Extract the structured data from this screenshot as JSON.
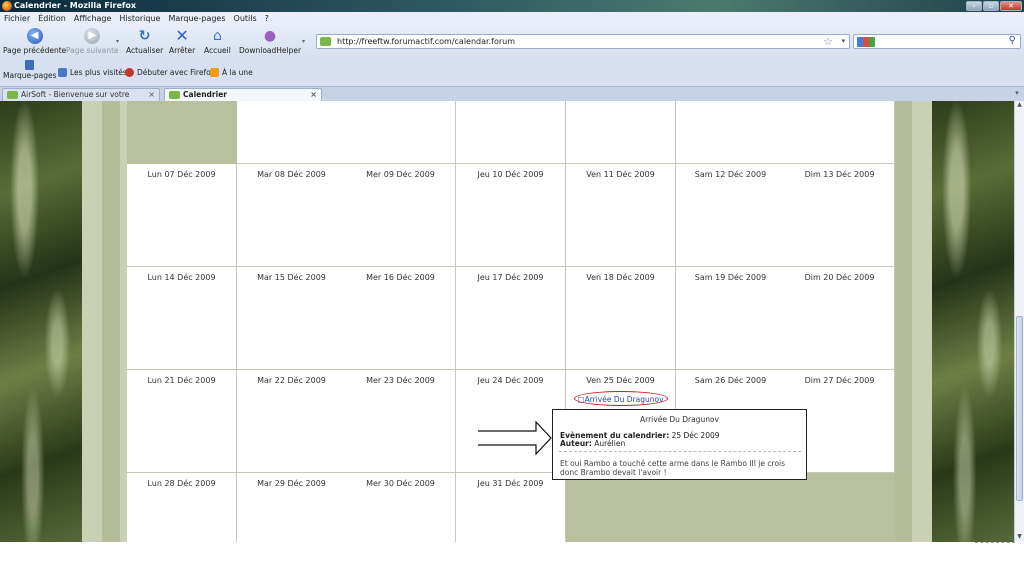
{
  "window": {
    "title": "Calendrier - Mozilla Firefox"
  },
  "menu": [
    "Fichier",
    "Édition",
    "Affichage",
    "Historique",
    "Marque-pages",
    "Outils",
    "?"
  ],
  "nav": {
    "back": "Page précédente",
    "forward": "Page suivante",
    "reload": "Actualiser",
    "stop": "Arrêter",
    "home": "Accueil",
    "downloadhelper": "DownloadHelper",
    "url": "http://freeftw.forumactif.com/calendar.forum",
    "search_value": ""
  },
  "bookmarks": {
    "main": "Marque-pages",
    "items": [
      "Les plus visités",
      "Débuter avec Firefox",
      "À la une"
    ]
  },
  "tabs": [
    {
      "label": "AirSoft - Bienvenue sur votre panne...",
      "active": false
    },
    {
      "label": "Calendrier",
      "active": true
    }
  ],
  "calendar": {
    "weeks": [
      [
        "",
        "",
        "",
        "",
        "",
        "",
        ""
      ],
      [
        "Lun 07 Déc 2009",
        "Mar 08 Déc 2009",
        "Mer 09 Déc 2009",
        "Jeu 10 Déc 2009",
        "Ven 11 Déc 2009",
        "Sam 12 Déc 2009",
        "Dim 13 Déc 2009"
      ],
      [
        "Lun 14 Déc 2009",
        "Mar 15 Déc 2009",
        "Mer 16 Déc 2009",
        "Jeu 17 Déc 2009",
        "Ven 18 Déc 2009",
        "Sam 19 Déc 2009",
        "Dim 20 Déc 2009"
      ],
      [
        "Lun 21 Déc 2009",
        "Mar 22 Déc 2009",
        "Mer 23 Déc 2009",
        "Jeu 24 Déc 2009",
        "Ven 25 Déc 2009",
        "Sam 26 Déc 2009",
        "Dim 27 Déc 2009"
      ],
      [
        "Lun 28 Déc 2009",
        "Mar 29 Déc 2009",
        "Mer 30 Déc 2009",
        "Jeu 31 Déc 2009",
        "",
        "",
        ""
      ]
    ],
    "event": {
      "link": "Arrivée Du Dragunov",
      "title": "Arrivée Du Dragunov",
      "date_label": "Evènement du calendrier:",
      "date_value": "25 Déc 2009",
      "author_label": "Auteur:",
      "author_value": "Aurélien",
      "body": "Et oui Rambo a touché cette arme dans le Rambo III je crois donc Brambo devait l'avoir !"
    }
  },
  "colors": {
    "accent_ring": "#cc2222",
    "link": "#2a4aa8",
    "panel": "#c9d0b3"
  }
}
